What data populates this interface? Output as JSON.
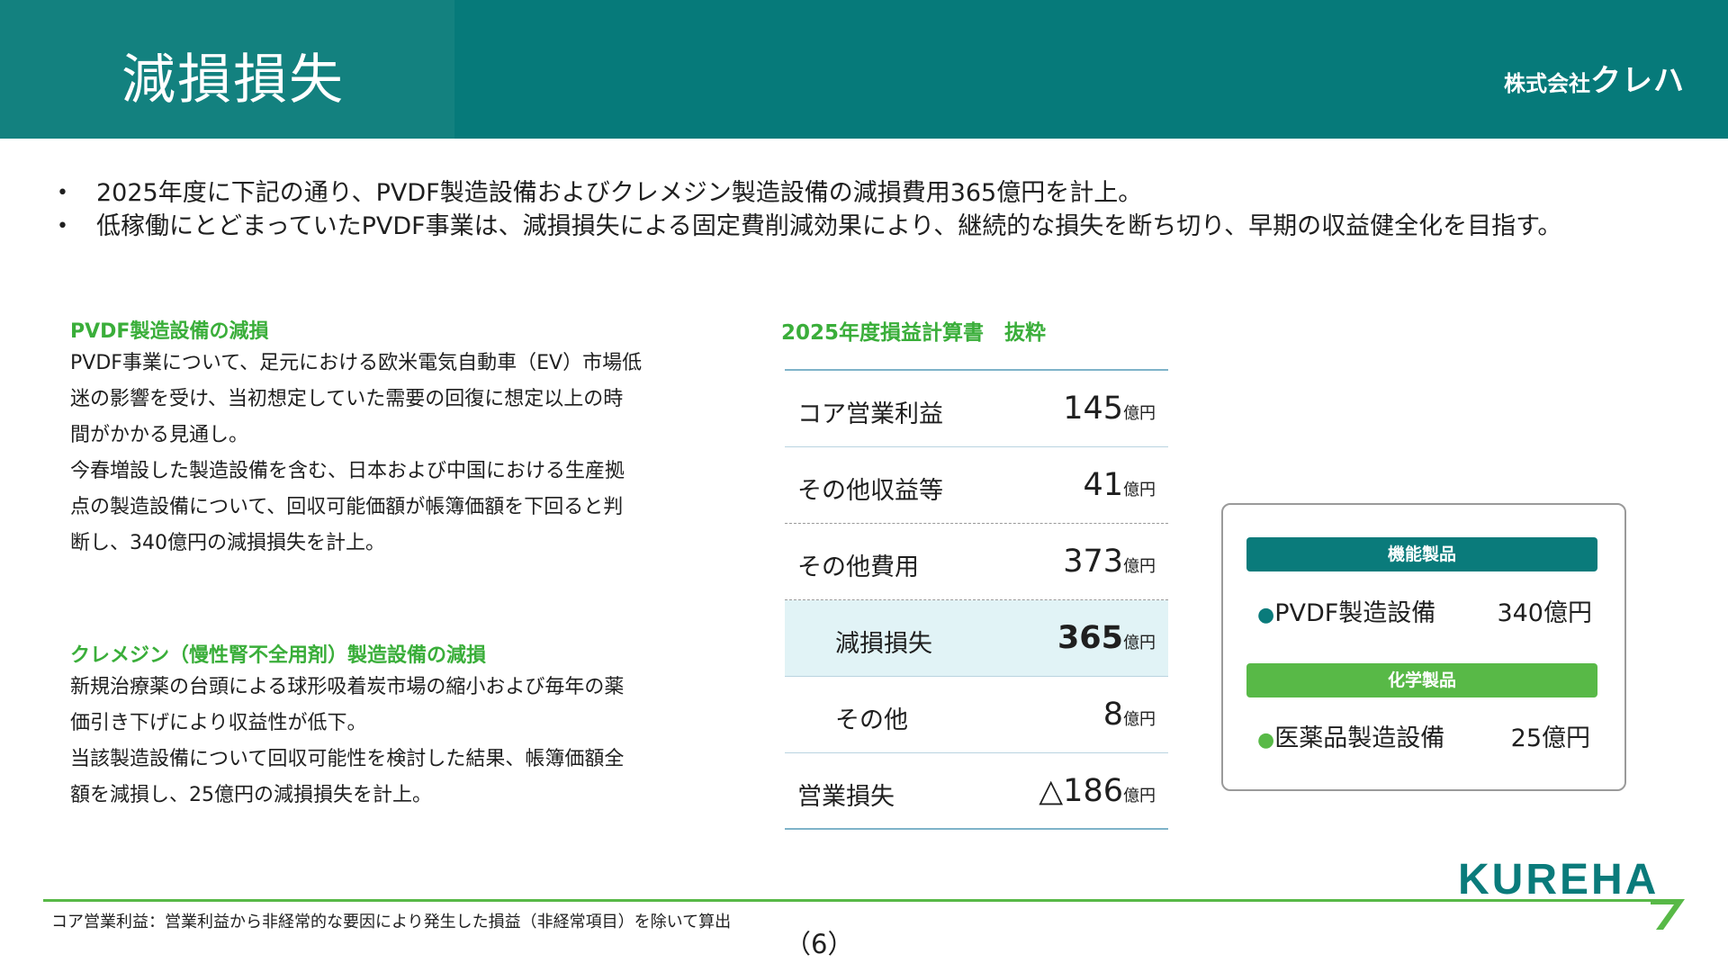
{
  "header": {
    "title": "減損損失",
    "company_prefix": "株式会社",
    "company_name": "クレハ"
  },
  "bullets": [
    "2025年度に下記の通り、PVDF製造設備およびクレメジン製造設備の減損費用365億円を計上。",
    "低稼働にとどまっていたPVDF事業は、減損損失による固定費削減効果により、継続的な損失を断ち切り、早期の収益健全化を目指す。"
  ],
  "sections": {
    "pvdf": {
      "title": "PVDF製造設備の減損",
      "lines": [
        "PVDF事業について、足元における欧米電気自動車（EV）市場低",
        "迷の影響を受け、当初想定していた需要の回復に想定以上の時",
        "間がかかる見通し。",
        "今春増設した製造設備を含む、日本および中国における生産拠",
        "点の製造設備について、回収可能価額が帳簿価額を下回ると判",
        "断し、340億円の減損損失を計上。"
      ]
    },
    "kremezin": {
      "title": "クレメジン（慢性腎不全用剤）製造設備の減損",
      "lines": [
        "新規治療薬の台頭による球形吸着炭市場の縮小および毎年の薬",
        "価引き下げにより収益性が低下。",
        "当該製造設備について回収可能性を検討した結果、帳簿価額全",
        "額を減損し、25億円の減損損失を計上。"
      ]
    }
  },
  "table": {
    "title": "2025年度損益計算書　抜粋",
    "unit": "億円",
    "rows": [
      {
        "label": "コア営業利益",
        "value": "145"
      },
      {
        "label": "その他収益等",
        "value": "41"
      },
      {
        "label": "その他費用",
        "value": "373"
      },
      {
        "label": "減損損失",
        "value": "365"
      },
      {
        "label": "その他",
        "value": "8"
      },
      {
        "label": "営業損失",
        "value": "△186"
      }
    ]
  },
  "breakdown": {
    "segments": [
      {
        "name": "機能製品",
        "item": "PVDF製造設備",
        "amount": "340億円"
      },
      {
        "name": "化学製品",
        "item": "医薬品製造設備",
        "amount": "25億円"
      }
    ],
    "bullet": "●"
  },
  "footer": {
    "logo": "KUREHA",
    "footnote": "コア営業利益：営業利益から非経常的な要因により発生した損益（非経常項目）を除いて算出",
    "page": "（6）"
  },
  "colors": {
    "header": "#067a7a",
    "accent_green": "#3aae3a",
    "teal": "#0a7b7b",
    "lime": "#58b947",
    "highlight": "#e1f3f6"
  }
}
